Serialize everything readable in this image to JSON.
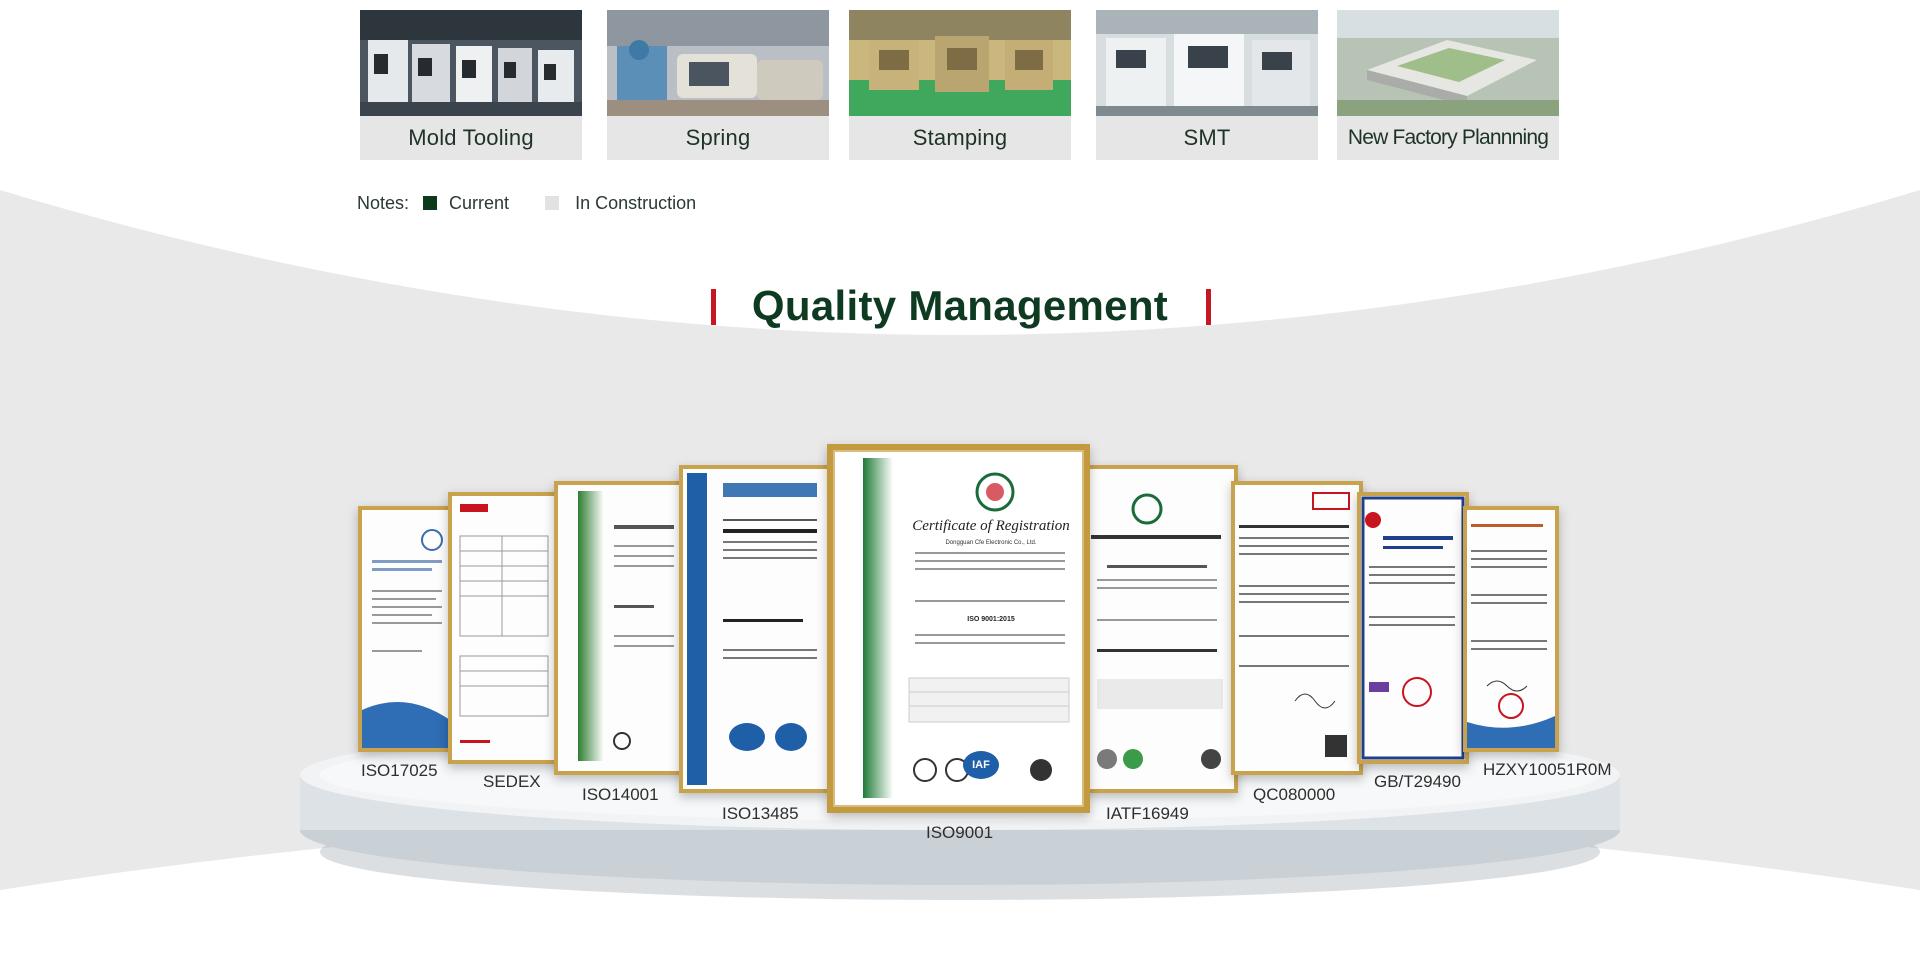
{
  "factory": {
    "cards": [
      {
        "label": "Mold Tooling"
      },
      {
        "label": "Spring"
      },
      {
        "label": "Stamping"
      },
      {
        "label": "SMT"
      },
      {
        "label": "New Factory Plannning"
      }
    ]
  },
  "notes": {
    "prefix": "Notes:",
    "current": "Current",
    "in_construction": "In Construction"
  },
  "section": {
    "title": "Quality Management"
  },
  "certificates": [
    {
      "name": "ISO17025"
    },
    {
      "name": "SEDEX"
    },
    {
      "name": "ISO14001"
    },
    {
      "name": "ISO13485"
    },
    {
      "name": "ISO9001"
    },
    {
      "name": "IATF16949"
    },
    {
      "name": "QC080000"
    },
    {
      "name": "GB/T29490"
    },
    {
      "name": "HZXY10051R0M"
    }
  ],
  "center_cert": {
    "heading": "Certificate of Registration",
    "company": "Dongguan Cfe Electronic Co., Ltd.",
    "standard": "ISO 9001:2015",
    "seal": "IAF"
  },
  "colors": {
    "brand_green": "#0e3a21",
    "accent_red": "#c41923",
    "frame_gold": "#c9a24d",
    "in_construction": "#e2e2e2"
  }
}
